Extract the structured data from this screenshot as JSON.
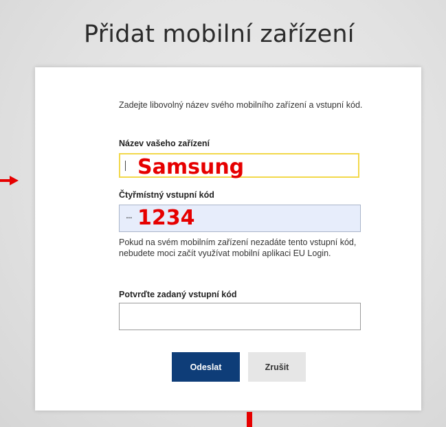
{
  "page": {
    "title": "Přidat mobilní zařízení"
  },
  "form": {
    "intro": "Zadejte libovolný název svého mobilního zařízení a vstupní kód.",
    "device_name_label": "Název vašeho zařízení",
    "device_name_value": "",
    "pin_label": "Čtyřmístný vstupní kód",
    "pin_masked": "...",
    "help_text": "Pokud na svém mobilním zařízení nezadáte tento vstupní kód, nebudete moci začít využívat mobilní aplikaci EU Login.",
    "confirm_label": "Potvrďte zadaný vstupní kód",
    "confirm_value": ""
  },
  "buttons": {
    "submit": "Odeslat",
    "cancel": "Zrušit"
  },
  "annotations": {
    "device_example": "Samsung",
    "pin_example": "1234",
    "color": "#e60000"
  },
  "colors": {
    "primary_button": "#0e3d78",
    "focus_border": "#f2d84a",
    "filled_field_bg": "#e7edfb"
  }
}
